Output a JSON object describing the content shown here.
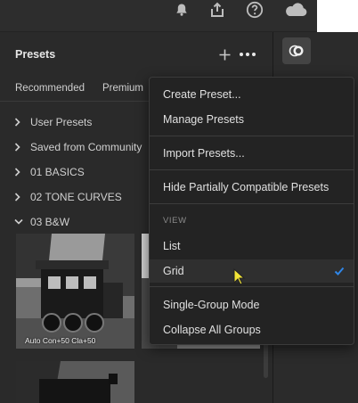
{
  "panel": {
    "title": "Presets",
    "tabs": [
      "Recommended",
      "Premium"
    ],
    "groups": [
      {
        "label": "User Presets",
        "expanded": false
      },
      {
        "label": "Saved from Community",
        "expanded": false
      },
      {
        "label": "01 BASICS",
        "expanded": false
      },
      {
        "label": "02 TONE CURVES",
        "expanded": false
      },
      {
        "label": "03 B&W",
        "expanded": true
      }
    ],
    "thumbnails": [
      {
        "caption": "Auto Con+50 Cla+50"
      }
    ]
  },
  "menu": {
    "items": {
      "create_preset": "Create Preset...",
      "manage_presets": "Manage Presets",
      "import_presets": "Import Presets...",
      "hide_partial": "Hide Partially Compatible Presets",
      "view_header": "VIEW",
      "list": "List",
      "grid": "Grid",
      "single_group": "Single-Group Mode",
      "collapse_all": "Collapse All Groups"
    },
    "selected_view": "Grid"
  },
  "colors": {
    "accent_check": "#2f86e8",
    "cursor": "#f2e437",
    "panel_bg": "#2a2a2a",
    "menu_bg": "#232323"
  },
  "icons": [
    "bell-icon",
    "share-icon",
    "help-icon",
    "cloud-icon",
    "plus-icon",
    "more-icon",
    "presets-toggle-icon",
    "chevron-right-icon",
    "chevron-down-icon",
    "checkmark-icon",
    "cursor-icon"
  ]
}
